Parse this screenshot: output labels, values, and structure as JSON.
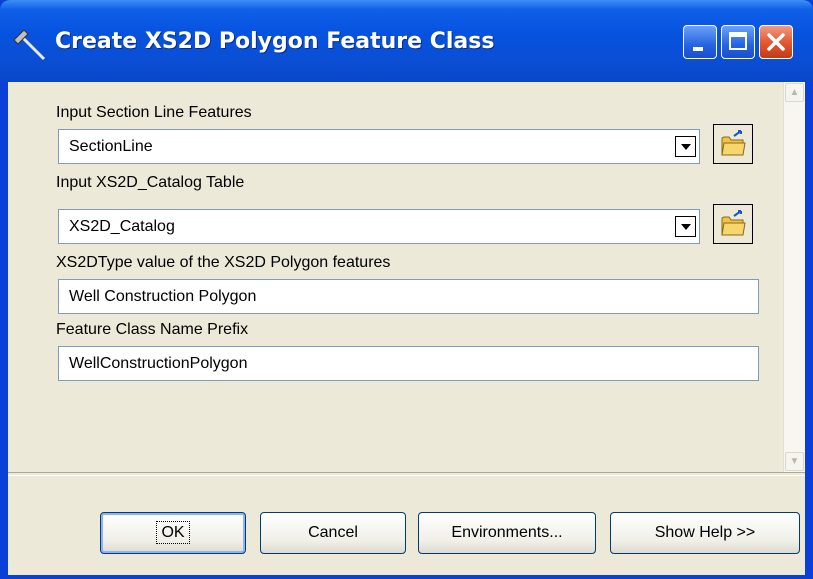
{
  "window": {
    "title": "Create XS2D Polygon Feature Class"
  },
  "icons": {
    "title": "tool-hammer-icon",
    "minimize": "minimize-icon",
    "maximize": "maximize-icon",
    "close": "close-icon",
    "browse": "open-folder-icon"
  },
  "fields": {
    "section_line_label": "Input Section Line Features",
    "section_line_value": "SectionLine",
    "catalog_label": "Input XS2D_Catalog Table",
    "catalog_value": "XS2D_Catalog",
    "type_label": "XS2DType value of the XS2D Polygon features",
    "type_value": "Well Construction Polygon",
    "prefix_label": "Feature Class Name Prefix",
    "prefix_value": "WellConstructionPolygon"
  },
  "buttons": {
    "ok": "OK",
    "cancel": "Cancel",
    "environments": "Environments...",
    "help": "Show Help >>"
  }
}
